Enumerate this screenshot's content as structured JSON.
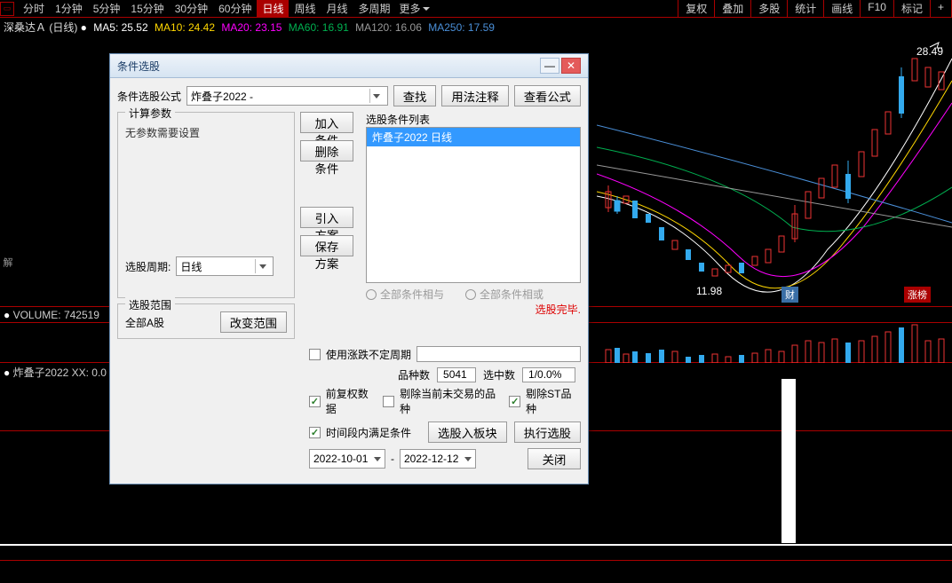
{
  "toolbar": {
    "timeframes": [
      "分时",
      "1分钟",
      "5分钟",
      "15分钟",
      "30分钟",
      "60分钟",
      "日线",
      "周线",
      "月线",
      "多周期",
      "更多"
    ],
    "active_timeframe": "日线",
    "right_buttons": [
      "复权",
      "叠加",
      "多股",
      "统计",
      "画线",
      "F10",
      "标记",
      "+"
    ]
  },
  "ma_line": {
    "title": "深桑达Ａ (日线)",
    "ma5": "MA5: 25.52",
    "ma10": "MA10: 24.42",
    "ma20": "MA20: 23.15",
    "ma60": "MA60: 16.91",
    "ma120": "MA120: 16.06",
    "ma250": "MA250: 17.59"
  },
  "chart": {
    "price_high": "28.49",
    "price_low": "11.98",
    "badge_cai": "财",
    "badge_bang": "涨榜"
  },
  "volume_line": "VOLUME: 742519",
  "left_strip": "解",
  "sub_indicator": "炸叠子2022  XX: 0.0",
  "dialog": {
    "title": "条件选股",
    "formula_label": "条件选股公式",
    "formula_value": "炸叠子2022   -",
    "btn_search": "查找",
    "btn_usage": "用法注释",
    "btn_view_formula": "查看公式",
    "params_title": "计算参数",
    "no_params_text": "无参数需要设置",
    "btn_add_cond": "加入条件",
    "btn_del_cond": "删除条件",
    "btn_import": "引入方案",
    "btn_save": "保存方案",
    "period_label": "选股周期:",
    "period_value": "日线",
    "list_title": "选股条件列表",
    "list_selected": "炸叠子2022  日线",
    "radio_and": "全部条件相与",
    "radio_or": "全部条件相或",
    "warning": "选股完毕.",
    "scope_title": "选股范围",
    "scope_value": "全部A股",
    "btn_change_scope": "改变范围",
    "chk_use_period": "使用涨跌不定周期",
    "stats_count_label": "品种数",
    "stats_count_value": "5041",
    "stats_selected_label": "选中数",
    "stats_selected_value": "1/0.0%",
    "chk_fqdata": "前复权数据",
    "chk_rm_notrade": "剔除当前未交易的品种",
    "chk_rm_st": "剔除ST品种",
    "chk_time_range": "时间段内满足条件",
    "btn_add_block": "选股入板块",
    "btn_run": "执行选股",
    "date_from": "2022-10-01",
    "date_sep": "-",
    "date_to": "2022-12-12",
    "btn_close": "关闭"
  },
  "chart_data": {
    "type": "candlestick",
    "title": "深桑达Ａ 日线",
    "high": 28.49,
    "low": 11.98,
    "ma_series": [
      {
        "name": "MA5",
        "value": 25.52
      },
      {
        "name": "MA10",
        "value": 24.42
      },
      {
        "name": "MA20",
        "value": 23.15
      },
      {
        "name": "MA60",
        "value": 16.91
      },
      {
        "name": "MA120",
        "value": 16.06
      },
      {
        "name": "MA250",
        "value": 17.59
      }
    ],
    "volume": 742519
  }
}
